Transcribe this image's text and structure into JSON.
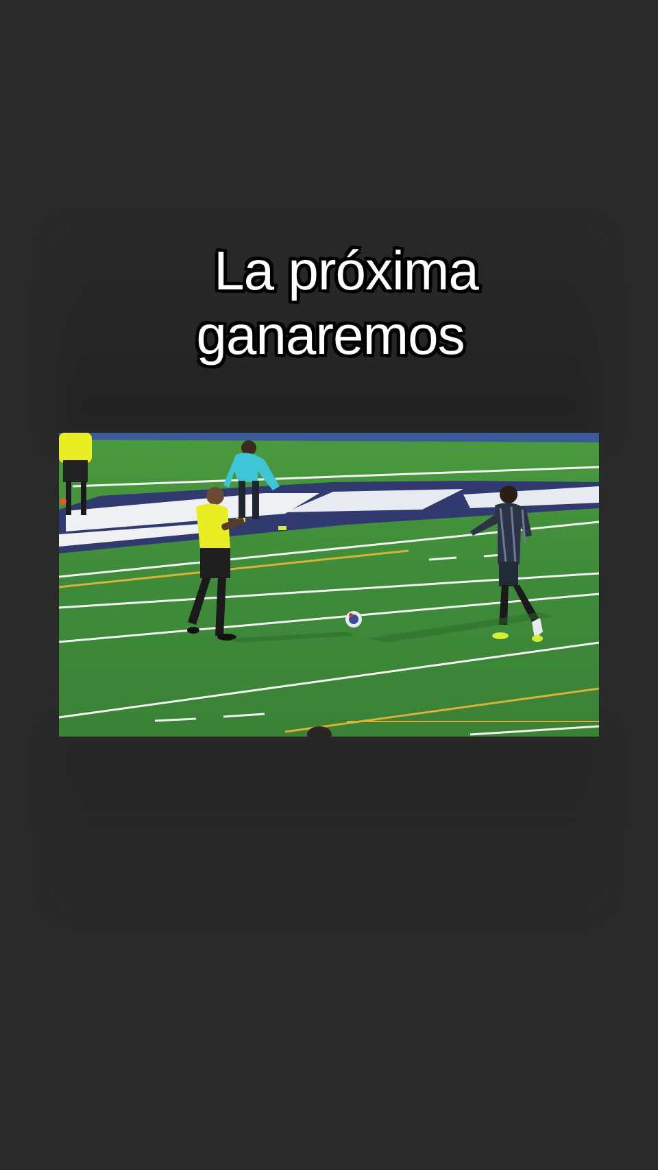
{
  "caption": {
    "line1": "La próxima",
    "line2": "ganaremos"
  },
  "colors": {
    "background": "#292929",
    "caption_text": "#ffffff",
    "caption_outline": "#000000",
    "field_green": "#3f8a3a",
    "referee_yellow": "#e8ee22",
    "goalkeeper_cyan": "#3fc6d6",
    "player_kit": "#2b3444"
  }
}
